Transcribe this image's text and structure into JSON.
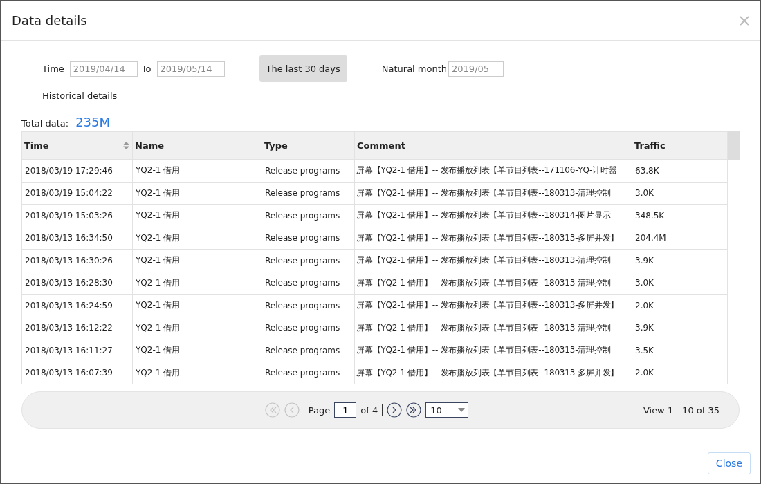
{
  "dialog": {
    "title": "Data details"
  },
  "filters": {
    "time_label": "Time",
    "from": "2019/04/14",
    "to_label": "To",
    "to": "2019/05/14",
    "last_30_button": "The last 30 days",
    "month_label": "Natural month",
    "month": "2019/05",
    "history_label": "Historical details"
  },
  "total": {
    "label": "Total data:",
    "value": "235M"
  },
  "table": {
    "columns": [
      {
        "label": "Time",
        "sortable": true
      },
      {
        "label": "Name",
        "sortable": false
      },
      {
        "label": "Type",
        "sortable": false
      },
      {
        "label": "Comment",
        "sortable": false
      },
      {
        "label": "Traffic",
        "sortable": false
      }
    ],
    "rows": [
      [
        "2018/03/19 17:29:46",
        "YQ2-1 借用",
        "Release programs",
        "屏幕【YQ2-1 借用】-- 发布播放列表【单节目列表--171106-YQ-计时器",
        "63.8K"
      ],
      [
        "2018/03/19 15:04:22",
        "YQ2-1 借用",
        "Release programs",
        "屏幕【YQ2-1 借用】-- 发布播放列表【单节目列表--180313-清理控制",
        "3.0K"
      ],
      [
        "2018/03/19 15:03:26",
        "YQ2-1 借用",
        "Release programs",
        "屏幕【YQ2-1 借用】-- 发布播放列表【单节目列表--180314-图片显示",
        "348.5K"
      ],
      [
        "2018/03/13 16:34:50",
        "YQ2-1 借用",
        "Release programs",
        "屏幕【YQ2-1 借用】-- 发布播放列表【单节目列表--180313-多屏并发】",
        "204.4M"
      ],
      [
        "2018/03/13 16:30:26",
        "YQ2-1 借用",
        "Release programs",
        "屏幕【YQ2-1 借用】-- 发布播放列表【单节目列表--180313-清理控制",
        "3.9K"
      ],
      [
        "2018/03/13 16:28:30",
        "YQ2-1 借用",
        "Release programs",
        "屏幕【YQ2-1 借用】-- 发布播放列表【单节目列表--180313-清理控制",
        "3.0K"
      ],
      [
        "2018/03/13 16:24:59",
        "YQ2-1 借用",
        "Release programs",
        "屏幕【YQ2-1 借用】-- 发布播放列表【单节目列表--180313-多屏并发】",
        "2.0K"
      ],
      [
        "2018/03/13 16:12:22",
        "YQ2-1 借用",
        "Release programs",
        "屏幕【YQ2-1 借用】-- 发布播放列表【单节目列表--180313-清理控制",
        "3.9K"
      ],
      [
        "2018/03/13 16:11:27",
        "YQ2-1 借用",
        "Release programs",
        "屏幕【YQ2-1 借用】-- 发布播放列表【单节目列表--180313-清理控制",
        "3.5K"
      ],
      [
        "2018/03/13 16:07:39",
        "YQ2-1 借用",
        "Release programs",
        "屏幕【YQ2-1 借用】-- 发布播放列表【单节目列表--180313-多屏并发】",
        "2.0K"
      ]
    ]
  },
  "pager": {
    "buttons": [
      {
        "kind": "first",
        "disabled": true
      },
      {
        "kind": "prev",
        "disabled": true
      },
      {
        "kind": "next",
        "disabled": false
      },
      {
        "kind": "last",
        "disabled": false
      }
    ],
    "page_label": "Page",
    "page": "1",
    "of_label": "of 4",
    "page_size": "10",
    "view": "View 1 - 10 of 35"
  },
  "close_button": "Close"
}
